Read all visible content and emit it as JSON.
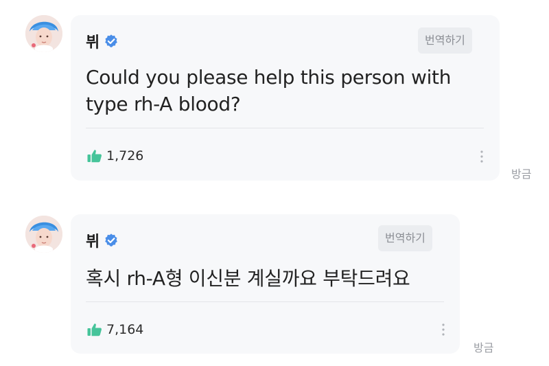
{
  "icons": {
    "verified": "verified-badge-icon",
    "like": "thumbs-up-icon",
    "more": "more-vertical-icon"
  },
  "colors": {
    "verified_badge": "#4a8ee8",
    "like_icon": "#46c49a",
    "bubble_bg": "#f7f8fa"
  },
  "comments": [
    {
      "author": "뷔",
      "translate_label": "번역하기",
      "text": "Could you please help this person with type rh-A blood?",
      "likes": "1,726",
      "time": "방금"
    },
    {
      "author": "뷔",
      "translate_label": "번역하기",
      "text": "혹시 rh-A형 이신분 계실까요 부탁드려요",
      "likes": "7,164",
      "time": "방금"
    }
  ]
}
